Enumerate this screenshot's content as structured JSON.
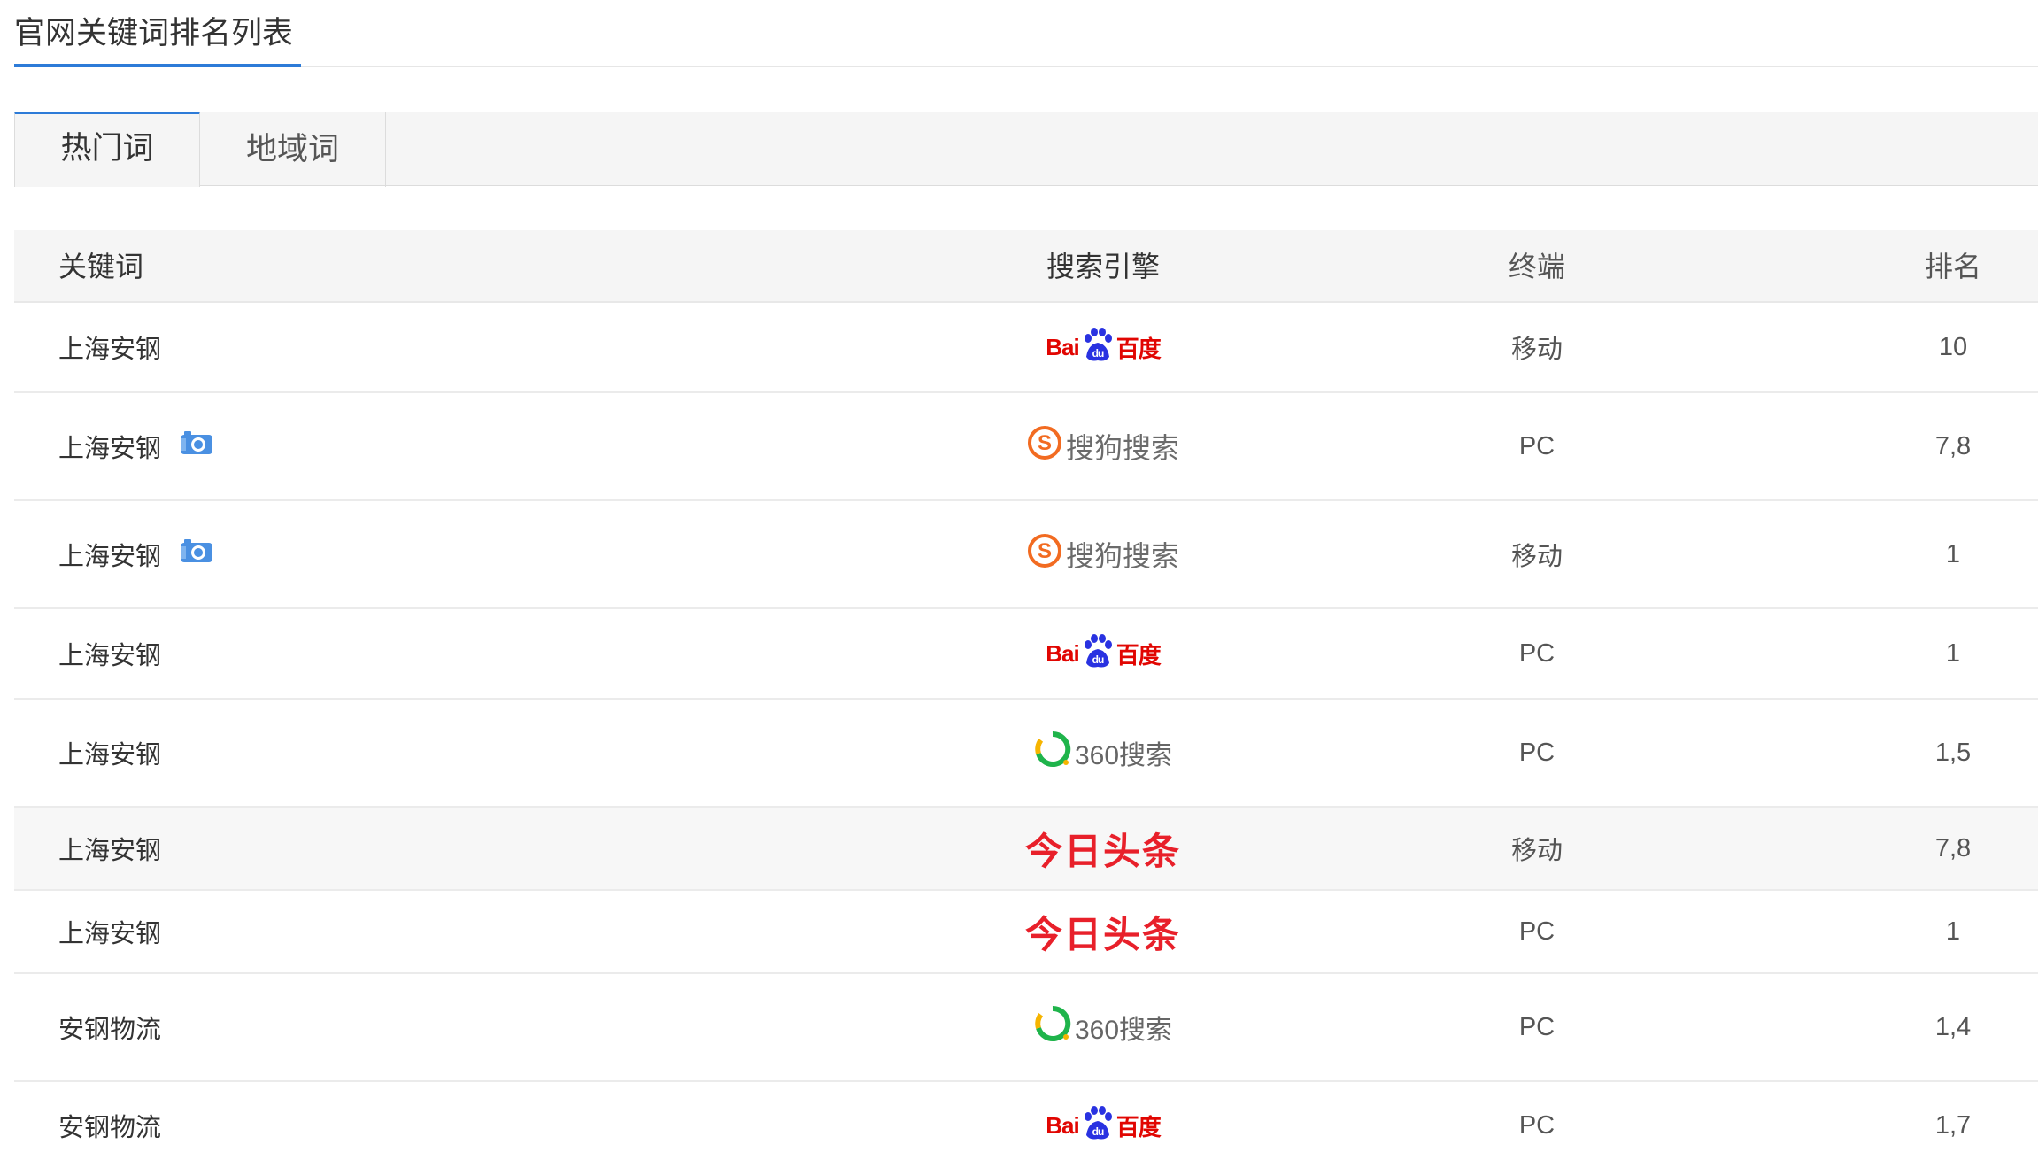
{
  "section": {
    "title": "官网关键词排名列表"
  },
  "tabs": [
    {
      "label": "热门词",
      "active": true
    },
    {
      "label": "地域词",
      "active": false
    }
  ],
  "table": {
    "headers": {
      "keyword": "关键词",
      "engine": "搜索引擎",
      "terminal": "终端",
      "rank": "排名"
    },
    "rows": [
      {
        "keyword": "上海安钢",
        "snapshot_icon": false,
        "engine": "baidu",
        "terminal": "移动",
        "rank": "10"
      },
      {
        "keyword": "上海安钢",
        "snapshot_icon": true,
        "engine": "sogou",
        "terminal": "PC",
        "rank": "7,8"
      },
      {
        "keyword": "上海安钢",
        "snapshot_icon": true,
        "engine": "sogou",
        "terminal": "移动",
        "rank": "1"
      },
      {
        "keyword": "上海安钢",
        "snapshot_icon": false,
        "engine": "baidu",
        "terminal": "PC",
        "rank": "1"
      },
      {
        "keyword": "上海安钢",
        "snapshot_icon": false,
        "engine": "so360",
        "terminal": "PC",
        "rank": "1,5"
      },
      {
        "keyword": "上海安钢",
        "snapshot_icon": false,
        "engine": "toutiao",
        "terminal": "移动",
        "rank": "7,8"
      },
      {
        "keyword": "上海安钢",
        "snapshot_icon": false,
        "engine": "toutiao",
        "terminal": "PC",
        "rank": "1"
      },
      {
        "keyword": "安钢物流",
        "snapshot_icon": false,
        "engine": "so360",
        "terminal": "PC",
        "rank": "1,4"
      },
      {
        "keyword": "安钢物流",
        "snapshot_icon": false,
        "engine": "baidu",
        "terminal": "PC",
        "rank": "1,7"
      }
    ]
  },
  "engine_logos": {
    "baidu": {
      "text_left": "Bai",
      "text_mid": "du",
      "text_right": "百度",
      "color": "#e10602",
      "paw_color": "#2932e1"
    },
    "sogou": {
      "text": "搜狗搜索",
      "badge": "S",
      "color": "#f26b21"
    },
    "so360": {
      "text": "360搜索",
      "ring_green": "#1fb44b",
      "ring_yellow": "#f6b400"
    },
    "toutiao": {
      "text": "今日头条",
      "color": "#e8202a"
    }
  },
  "colors": {
    "accent": "#2d7bd8",
    "header_bg": "#f5f5f5"
  }
}
